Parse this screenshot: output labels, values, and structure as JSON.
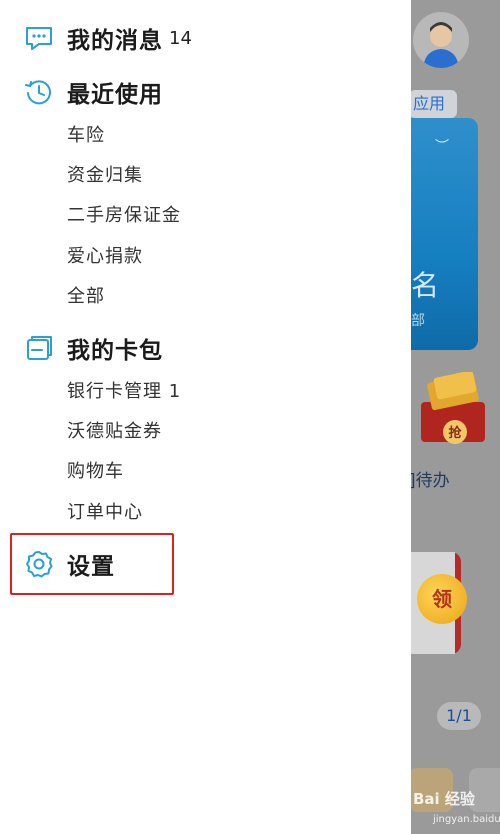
{
  "drawer": {
    "messages": {
      "title": "我的消息",
      "count": "14",
      "icon": "chat-bubble-icon"
    },
    "recent": {
      "title": "最近使用",
      "icon": "history-clock-icon",
      "items": [
        "车险",
        "资金归集",
        "二手房保证金",
        "爱心捐款",
        "全部"
      ]
    },
    "wallet": {
      "title": "我的卡包",
      "icon": "card-wallet-icon",
      "items": [
        "银行卡管理 1",
        "沃德贴金券",
        "购物车",
        "订单中心"
      ]
    },
    "settings": {
      "title": "设置",
      "icon": "gear-icon",
      "highlight_color": "#e0201e"
    }
  },
  "background": {
    "apps_chip": "应用",
    "card_big_text": "名",
    "card_small_text": "部",
    "gift_label": "抢",
    "todo_label": "]待办",
    "coin_label": "领",
    "page_indicator": "1/1",
    "watermark_main": "Bai 经验",
    "watermark_sub": "jingyan.baidu.com"
  },
  "colors": {
    "accent_blue": "#2a9fd8",
    "highlight_red": "#e0201e"
  }
}
